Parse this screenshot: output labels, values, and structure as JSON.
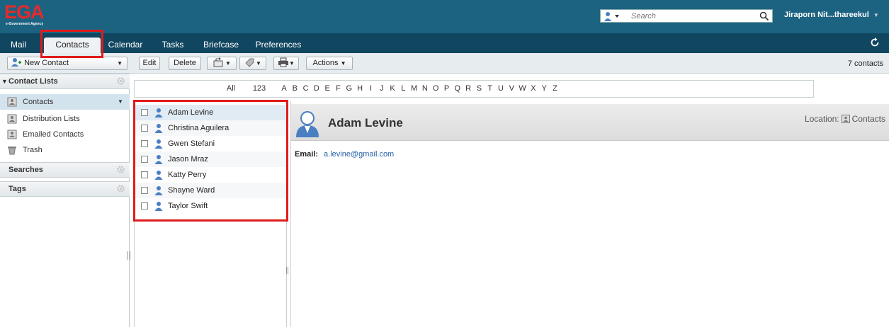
{
  "logo": {
    "text": "EGA",
    "subtitle": "e-Government Agency"
  },
  "header": {
    "search_placeholder": "Search",
    "user": "Jiraporn Nit...thareekul"
  },
  "nav": {
    "tabs": [
      "Mail",
      "Contacts",
      "Calendar",
      "Tasks",
      "Briefcase",
      "Preferences"
    ],
    "active": "Contacts"
  },
  "toolbar": {
    "new_contact": "New Contact",
    "edit": "Edit",
    "delete": "Delete",
    "actions": "Actions",
    "count": "7 contacts"
  },
  "sidebar": {
    "contact_lists_header": "Contact Lists",
    "items": [
      {
        "label": "Contacts",
        "icon": "contacts-book-icon",
        "selected": true
      },
      {
        "label": "Distribution Lists",
        "icon": "distribution-list-icon"
      },
      {
        "label": "Emailed Contacts",
        "icon": "emailed-contacts-icon"
      },
      {
        "label": "Trash",
        "icon": "trash-icon"
      }
    ],
    "searches_header": "Searches",
    "tags_header": "Tags"
  },
  "alpha_bar": [
    "All",
    "123",
    "A",
    "B",
    "C",
    "D",
    "E",
    "F",
    "G",
    "H",
    "I",
    "J",
    "K",
    "L",
    "M",
    "N",
    "O",
    "P",
    "Q",
    "R",
    "S",
    "T",
    "U",
    "V",
    "W",
    "X",
    "Y",
    "Z"
  ],
  "contacts": [
    "Adam Levine",
    "Christina Aguilera",
    "Gwen Stefani",
    "Jason Mraz",
    "Katty Perry",
    "Shayne Ward",
    "Taylor Swift"
  ],
  "detail": {
    "name": "Adam Levine",
    "location_label": "Location:",
    "location_value": "Contacts",
    "email_label": "Email:",
    "email_value": "a.levine@gmail.com"
  },
  "colors": {
    "header_bg": "#1c6382",
    "nav_bg": "#10465f",
    "highlight_box": "#e01b1b",
    "selection": "#e1ebf4"
  }
}
